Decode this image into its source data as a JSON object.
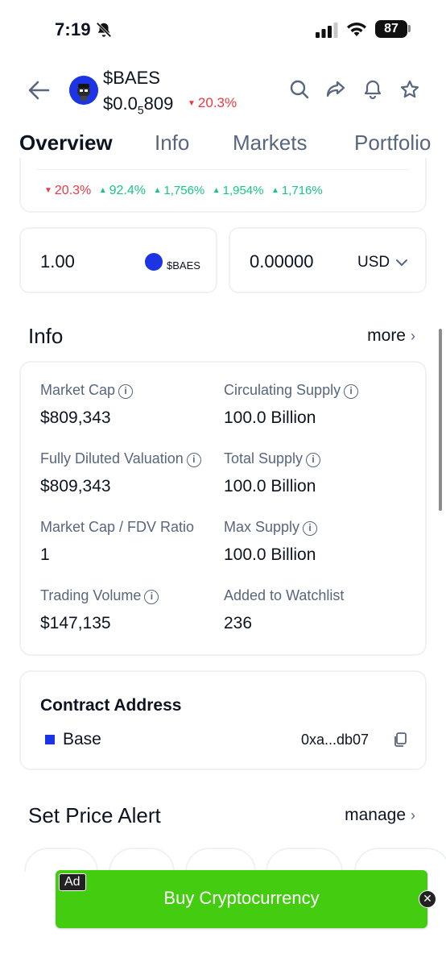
{
  "status_bar": {
    "time": "7:19",
    "battery": "87",
    "icons": [
      "bell-slash-icon",
      "cellular-signal-icon",
      "wifi-icon",
      "battery-icon"
    ]
  },
  "header": {
    "coin_name": "$BAES",
    "price_prefix": "$0.0",
    "price_subscript": "5",
    "price_suffix": "809",
    "change": "20.3%",
    "change_direction": "down",
    "icons": [
      "back-arrow-icon",
      "search-icon",
      "share-icon",
      "bell-icon",
      "star-icon"
    ]
  },
  "tabs": [
    {
      "label": "Overview",
      "active": true
    },
    {
      "label": "Info",
      "active": false
    },
    {
      "label": "Markets",
      "active": false
    },
    {
      "label": "Portfolio",
      "active": false
    }
  ],
  "performance": [
    {
      "value": "20.3%",
      "direction": "down"
    },
    {
      "value": "92.4%",
      "direction": "up"
    },
    {
      "value": "1,756%",
      "direction": "up"
    },
    {
      "value": "1,954%",
      "direction": "up"
    },
    {
      "value": "1,716%",
      "direction": "up"
    }
  ],
  "converter": {
    "amount": "1.00",
    "coin_symbol": "$BAES",
    "result": "0.00000",
    "currency": "USD"
  },
  "info": {
    "title": "Info",
    "more_label": "more",
    "stats": [
      {
        "label": "Market Cap",
        "value": "$809,343",
        "has_info": true
      },
      {
        "label": "Circulating Supply",
        "value": "100.0 Billion",
        "has_info": true
      },
      {
        "label": "Fully Diluted Valuation",
        "value": "$809,343",
        "has_info": true
      },
      {
        "label": "Total Supply",
        "value": "100.0 Billion",
        "has_info": true
      },
      {
        "label": "Market Cap / FDV Ratio",
        "value": "1",
        "has_info": false
      },
      {
        "label": "Max Supply",
        "value": "100.0 Billion",
        "has_info": true
      },
      {
        "label": "Trading Volume",
        "value": "$147,135",
        "has_info": true
      },
      {
        "label": "Added to Watchlist",
        "value": "236",
        "has_info": false
      }
    ]
  },
  "contract": {
    "title": "Contract Address",
    "chain": "Base",
    "address": "0xa...db07"
  },
  "price_alert": {
    "title": "Set Price Alert",
    "manage_label": "manage"
  },
  "ad": {
    "label": "Ad",
    "text": "Buy Cryptocurrency",
    "color": "#44cc11"
  },
  "colors": {
    "up": "#16c784",
    "down": "#ea3943",
    "text_primary": "#0d1421",
    "text_secondary": "#58667e",
    "brand_blue": "#1c34e3"
  }
}
